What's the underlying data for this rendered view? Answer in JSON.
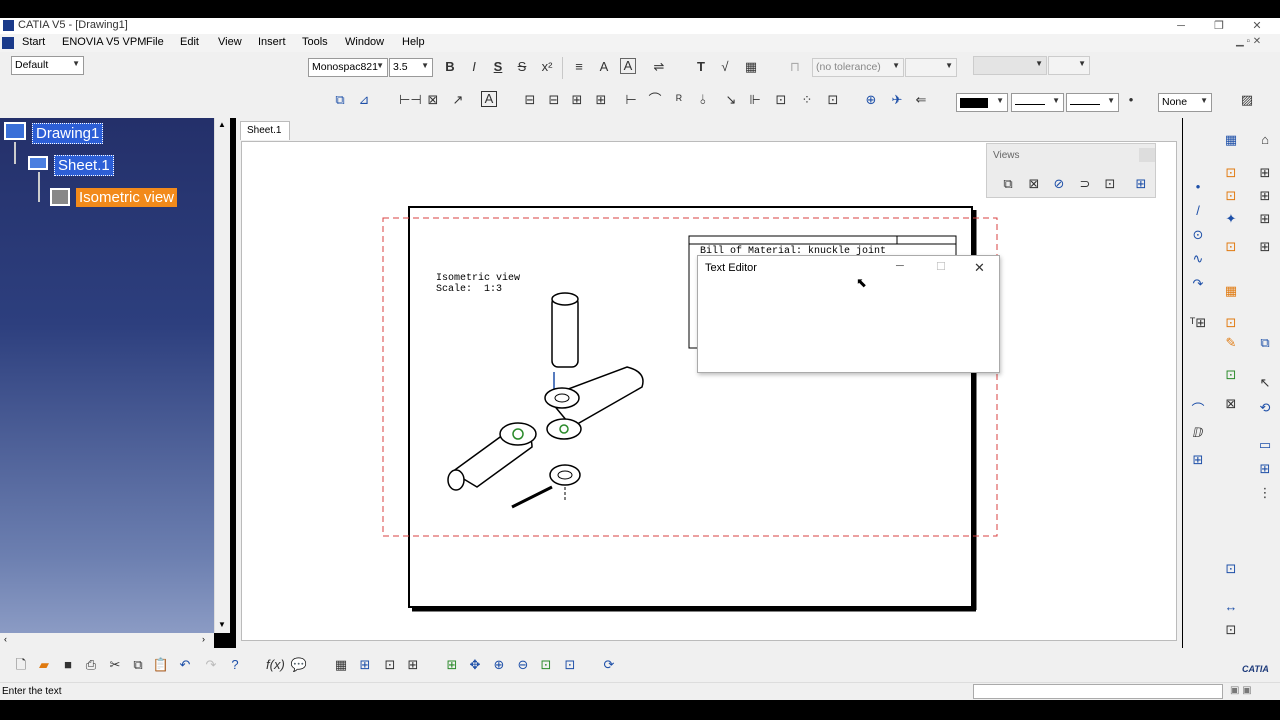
{
  "window": {
    "title": "CATIA V5 - [Drawing1]",
    "minimize": "─",
    "restore": "❐",
    "close": "✕"
  },
  "menubar": {
    "items": [
      "Start",
      "ENOVIA V5 VPM",
      "File",
      "Edit",
      "View",
      "Insert",
      "Tools",
      "Window",
      "Help"
    ]
  },
  "toolbar": {
    "style_combo": "Default",
    "font_combo": "Monospac821",
    "size_combo": "3.5",
    "tolerance_combo": "(no tolerance)",
    "line_none_combo": "None"
  },
  "tree": {
    "root": "Drawing1",
    "sheet": "Sheet.1",
    "view": "Isometric view"
  },
  "sheet_tab": "Sheet.1",
  "drawing": {
    "view_label": "Isometric view",
    "scale_label": "Scale:  1:3",
    "bom_title": "Bill of Material: knuckle joint"
  },
  "views_toolbar": {
    "title": "Views"
  },
  "text_editor": {
    "title": "Text Editor",
    "minimize": "─",
    "maximize": "☐",
    "close": "✕"
  },
  "status": {
    "text": "Enter the text"
  },
  "brand": {
    "name": "CATIA"
  },
  "colors": {
    "tree_bg": "#2d3f7e",
    "tree_selected": "#2d5fd6",
    "tree_view_selected": "#f28a1b",
    "frame_dashed": "#d94040"
  }
}
